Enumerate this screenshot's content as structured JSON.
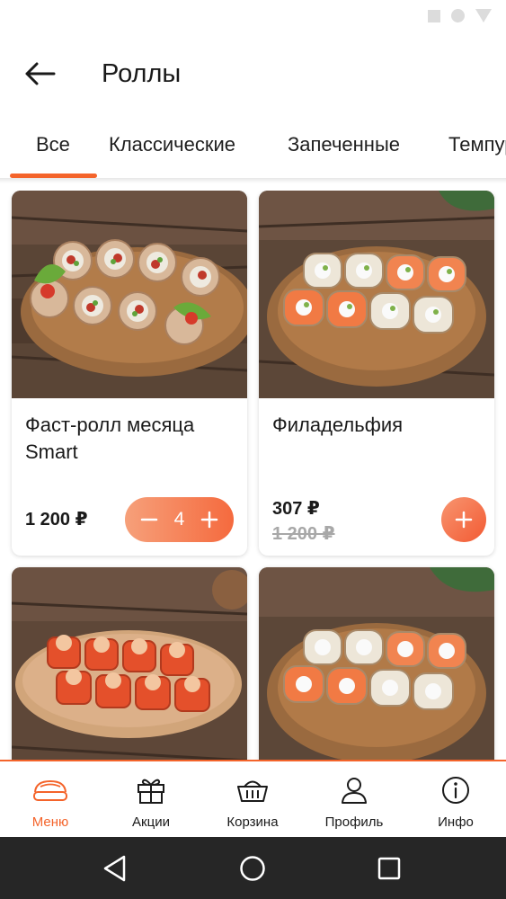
{
  "header": {
    "title": "Роллы"
  },
  "tabs": [
    {
      "label": "Все",
      "active": true
    },
    {
      "label": "Классические",
      "active": false
    },
    {
      "label": "Запеченные",
      "active": false
    },
    {
      "label": "Темпура",
      "active": false
    }
  ],
  "products": [
    {
      "name": "Фаст-ролл месяца Smart",
      "price": "1 200 ₽",
      "quantity": "4"
    },
    {
      "name": "Филадельфия",
      "price": "307 ₽",
      "old_price": "1 200 ₽"
    }
  ],
  "bottom_nav": [
    {
      "label": "Меню",
      "icon": "sushi-icon",
      "active": true
    },
    {
      "label": "Акции",
      "icon": "gift-icon",
      "active": false
    },
    {
      "label": "Корзина",
      "icon": "basket-icon",
      "active": false
    },
    {
      "label": "Профиль",
      "icon": "user-icon",
      "active": false
    },
    {
      "label": "Инфо",
      "icon": "info-icon",
      "active": false
    }
  ],
  "colors": {
    "accent": "#f4642b",
    "system_nav": "#262626"
  }
}
